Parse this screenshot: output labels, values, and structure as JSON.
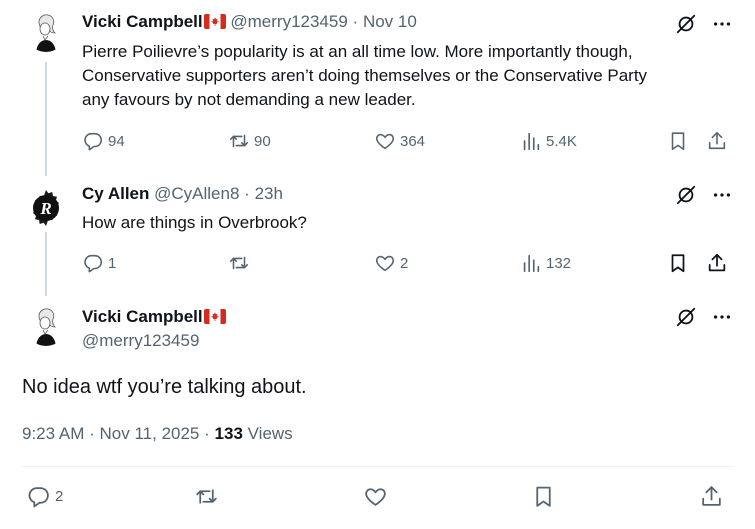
{
  "tweets": [
    {
      "name": "Vicki Campbell",
      "flag": "🇨🇦",
      "handle": "@merry123459",
      "dot": "·",
      "time": "Nov 10",
      "lines": [
        "Pierre Poilievre’s popularity is at an all time low. More importantly though,",
        "Conservative supporters aren’t doing themselves or the Conservative Party",
        "any favours by not demanding a new leader."
      ],
      "replies": "94",
      "reposts": "90",
      "likes": "364",
      "views": "5.4K"
    },
    {
      "name": "Cy Allen",
      "handle": "@CyAllen8",
      "dot": "·",
      "time": "23h",
      "text": "How are things in Overbrook?",
      "replies": "1",
      "reposts": "",
      "likes": "2",
      "views": "132"
    }
  ],
  "main": {
    "name": "Vicki Campbell",
    "flag": "🇨🇦",
    "handle": "@merry123459",
    "text": "No idea wtf you’re talking about.",
    "time": "9:23 AM",
    "dot1": "·",
    "date": "Nov 11, 2025",
    "dot2": "·",
    "views_count": "133",
    "views_label": "Views",
    "replies": "2"
  },
  "colors": {
    "text": "#0f1419",
    "secondary": "#536471",
    "thread_line": "#cfd9de",
    "flag_red": "#d52b1e"
  },
  "icons": [
    "grok-icon",
    "more-icon",
    "reply-icon",
    "repost-icon",
    "like-icon",
    "views-icon",
    "bookmark-icon",
    "share-icon",
    "flag-canada-icon"
  ]
}
